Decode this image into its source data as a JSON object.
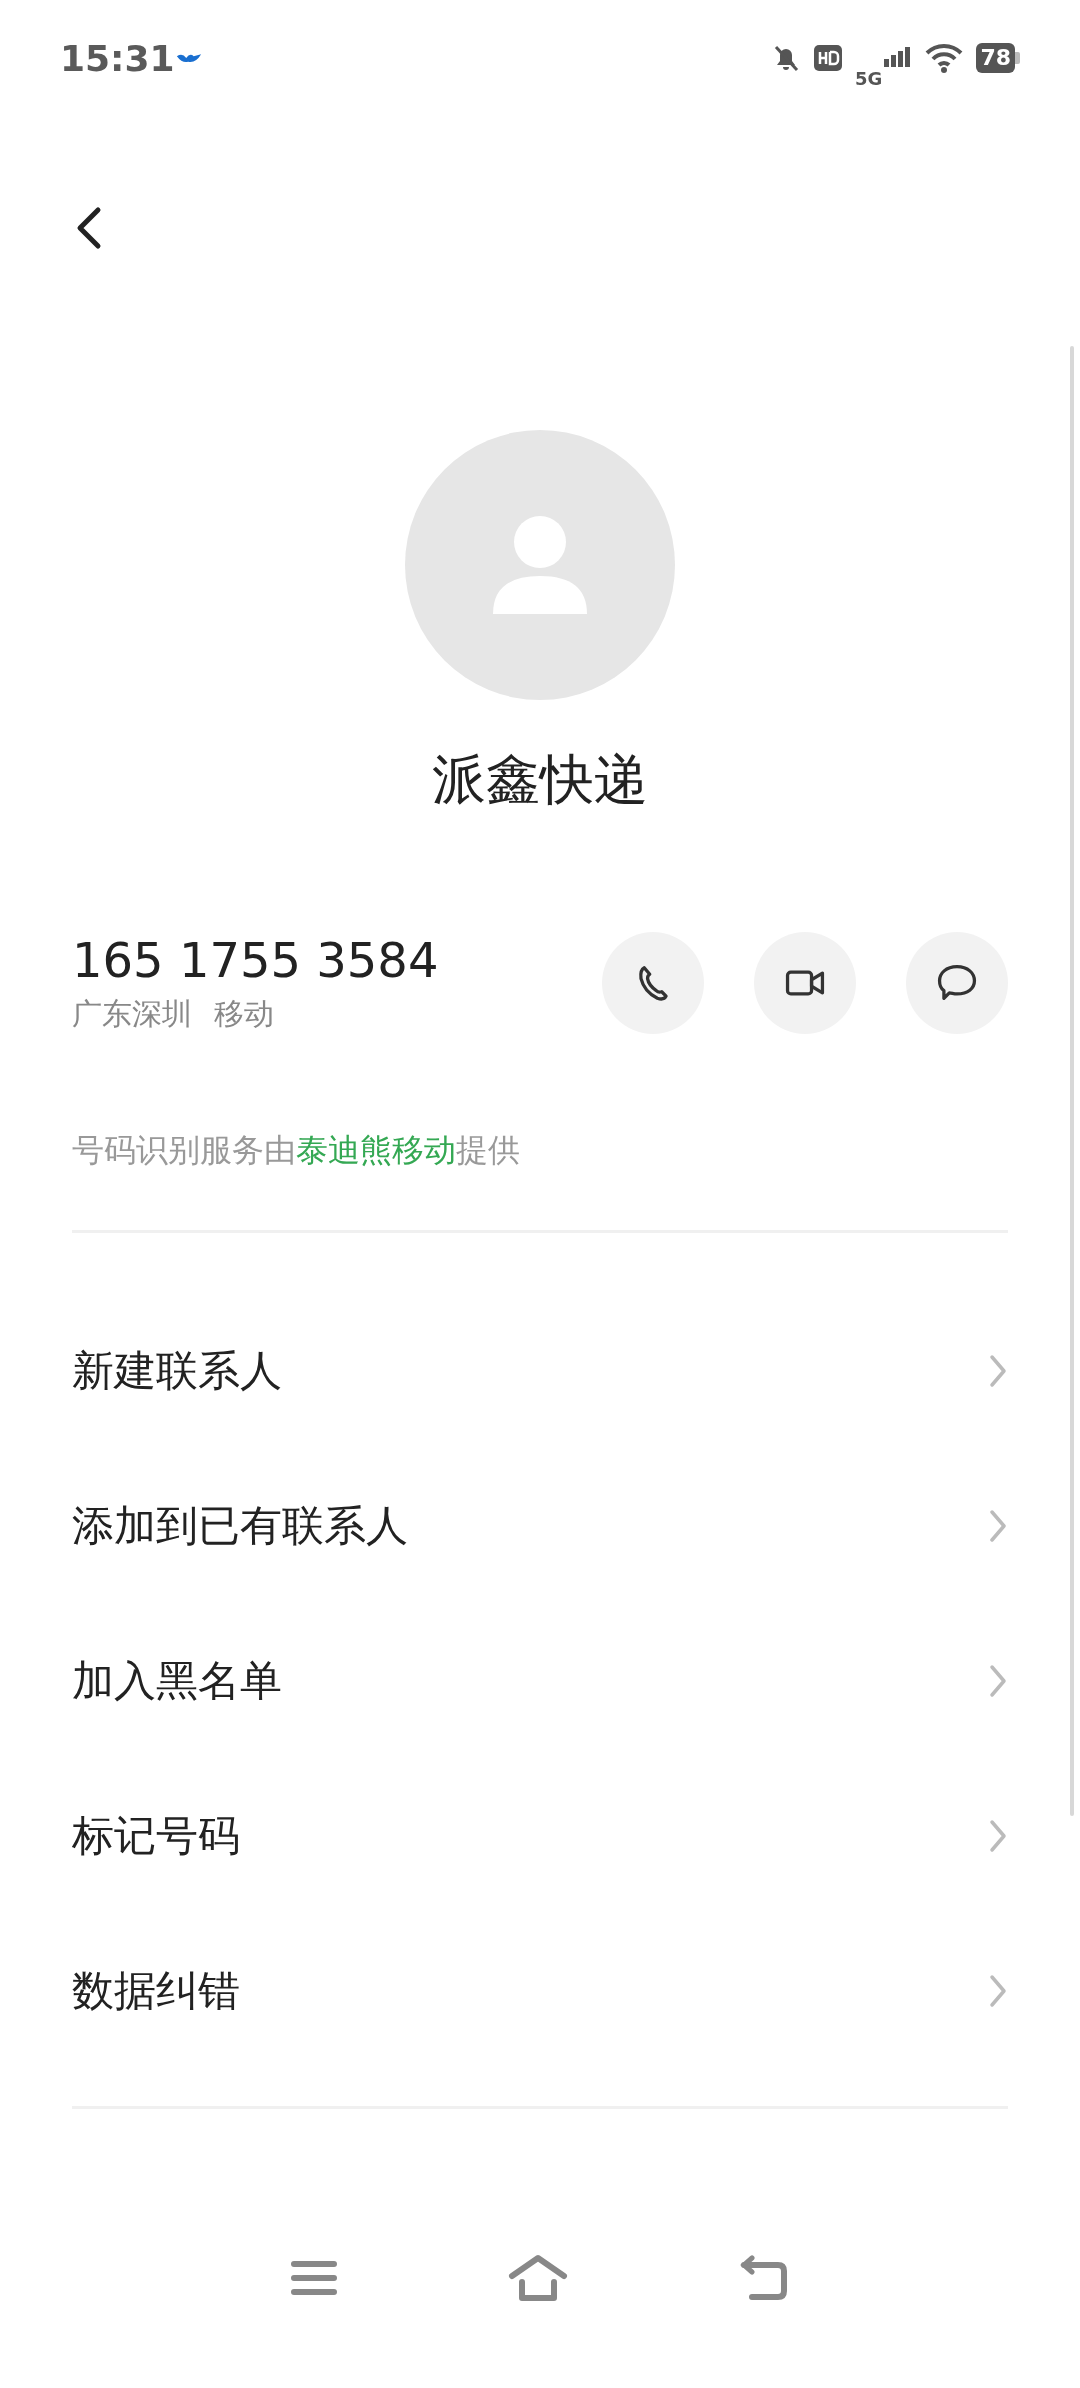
{
  "status_bar": {
    "time": "15:31",
    "battery": "78",
    "network": "5G"
  },
  "contact": {
    "name": "派鑫快递"
  },
  "number": {
    "phone": "165 1755 3584",
    "location": "广东深圳",
    "carrier": "移动"
  },
  "actions": [
    {
      "kind": "call"
    },
    {
      "kind": "video"
    },
    {
      "kind": "message"
    }
  ],
  "attribution": {
    "prefix": "号码识别服务由",
    "provider": "泰迪熊移动",
    "suffix": "提供"
  },
  "menu": [
    {
      "label": "新建联系人"
    },
    {
      "label": "添加到已有联系人"
    },
    {
      "label": "加入黑名单"
    },
    {
      "label": "标记号码"
    },
    {
      "label": "数据纠错"
    }
  ]
}
